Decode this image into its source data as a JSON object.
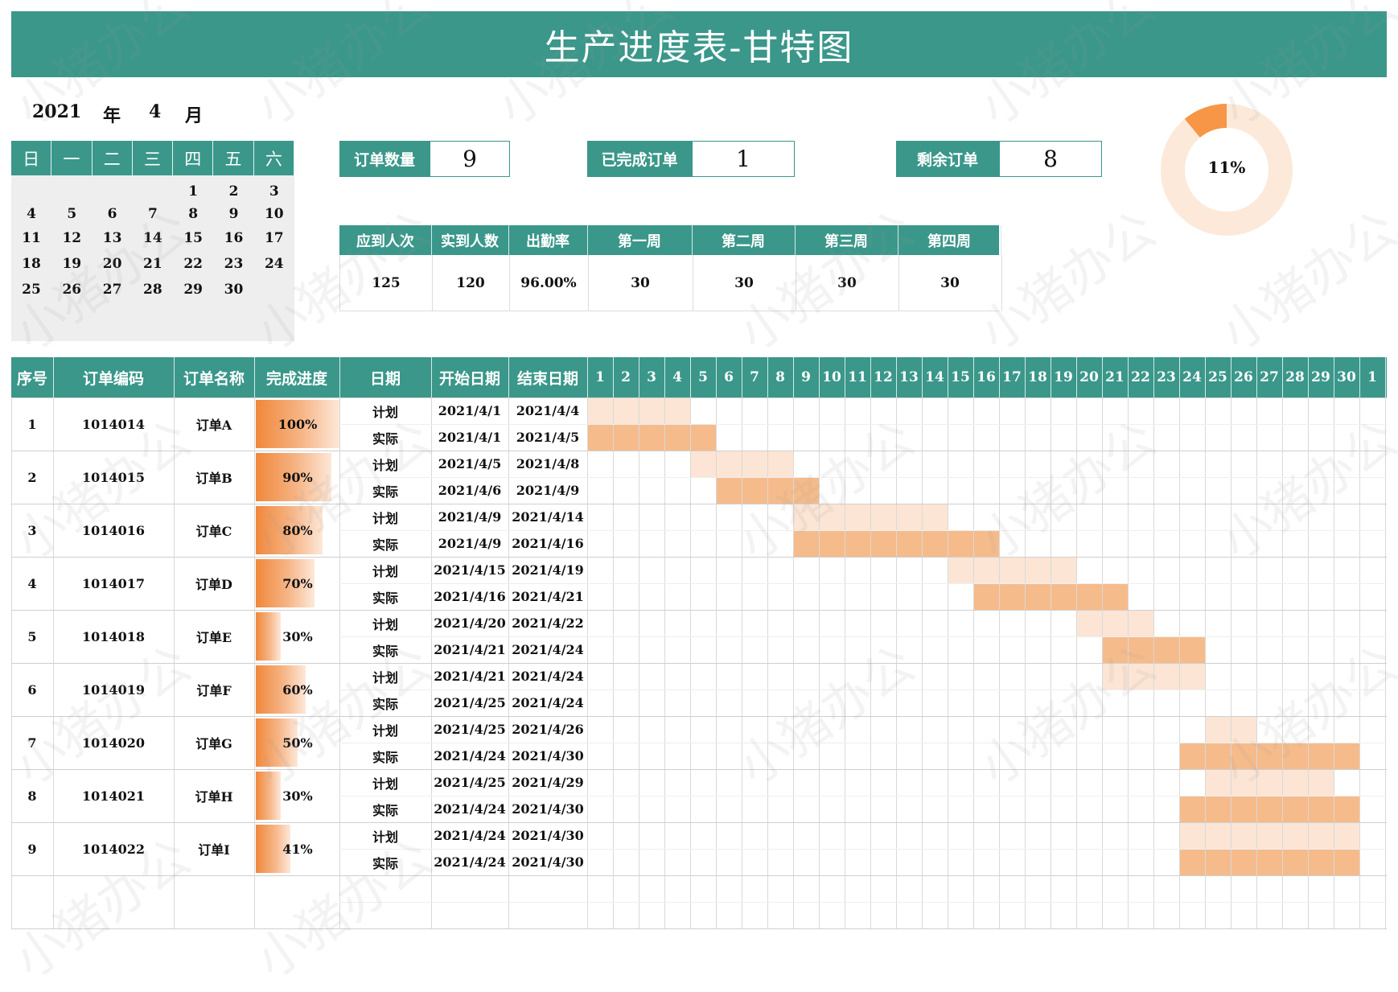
{
  "title": "生产进度表-甘特图",
  "date_header": {
    "year": "2021",
    "year_unit": "年",
    "month": "4",
    "month_unit": "月"
  },
  "calendar": {
    "weekdays": [
      "日",
      "一",
      "二",
      "三",
      "四",
      "五",
      "六"
    ],
    "days": [
      [
        "",
        "",
        "",
        "",
        "1",
        "2",
        "3"
      ],
      [
        "4",
        "5",
        "6",
        "7",
        "8",
        "9",
        "10"
      ],
      [
        "11",
        "12",
        "13",
        "14",
        "15",
        "16",
        "17"
      ],
      [
        "18",
        "19",
        "20",
        "21",
        "22",
        "23",
        "24"
      ],
      [
        "25",
        "26",
        "27",
        "28",
        "29",
        "30",
        ""
      ]
    ]
  },
  "kpis": [
    {
      "label": "订单数量",
      "value": "9"
    },
    {
      "label": "已完成订单",
      "value": "1"
    },
    {
      "label": "剩余订单",
      "value": "8"
    }
  ],
  "donut": {
    "percent": 0.11,
    "label": "11%",
    "fill_color": "#f79646",
    "track_color": "#fde9d9"
  },
  "stats": {
    "headers": [
      "应到人次",
      "实到人数",
      "出勤率",
      "第一周",
      "第二周",
      "第三周",
      "第四周"
    ],
    "values": [
      "125",
      "120",
      "96.00%",
      "30",
      "30",
      "30",
      "30"
    ]
  },
  "table": {
    "headers": [
      "序号",
      "订单编码",
      "订单名称",
      "完成进度",
      "日期",
      "开始日期",
      "结束日期"
    ],
    "day_headers": [
      "1",
      "2",
      "3",
      "4",
      "5",
      "6",
      "7",
      "8",
      "9",
      "10",
      "11",
      "12",
      "13",
      "14",
      "15",
      "16",
      "17",
      "18",
      "19",
      "20",
      "21",
      "22",
      "23",
      "24",
      "25",
      "26",
      "27",
      "28",
      "29",
      "30",
      "1"
    ],
    "plan_label": "计划",
    "actual_label": "实际",
    "orders": [
      {
        "no": "1",
        "code": "1014014",
        "name": "订单A",
        "progress": 1.0,
        "progress_label": "100%",
        "plan": {
          "start": "2021/4/1",
          "end": "2021/4/4",
          "s": 1,
          "e": 4
        },
        "actual": {
          "start": "2021/4/1",
          "end": "2021/4/5",
          "s": 1,
          "e": 5
        }
      },
      {
        "no": "2",
        "code": "1014015",
        "name": "订单B",
        "progress": 0.9,
        "progress_label": "90%",
        "plan": {
          "start": "2021/4/5",
          "end": "2021/4/8",
          "s": 5,
          "e": 8
        },
        "actual": {
          "start": "2021/4/6",
          "end": "2021/4/9",
          "s": 6,
          "e": 9
        }
      },
      {
        "no": "3",
        "code": "1014016",
        "name": "订单C",
        "progress": 0.8,
        "progress_label": "80%",
        "plan": {
          "start": "2021/4/9",
          "end": "2021/4/14",
          "s": 9,
          "e": 14
        },
        "actual": {
          "start": "2021/4/9",
          "end": "2021/4/16",
          "s": 9,
          "e": 16
        }
      },
      {
        "no": "4",
        "code": "1014017",
        "name": "订单D",
        "progress": 0.7,
        "progress_label": "70%",
        "plan": {
          "start": "2021/4/15",
          "end": "2021/4/19",
          "s": 15,
          "e": 19
        },
        "actual": {
          "start": "2021/4/16",
          "end": "2021/4/21",
          "s": 16,
          "e": 21
        }
      },
      {
        "no": "5",
        "code": "1014018",
        "name": "订单E",
        "progress": 0.3,
        "progress_label": "30%",
        "plan": {
          "start": "2021/4/20",
          "end": "2021/4/22",
          "s": 20,
          "e": 22
        },
        "actual": {
          "start": "2021/4/21",
          "end": "2021/4/24",
          "s": 21,
          "e": 24
        }
      },
      {
        "no": "6",
        "code": "1014019",
        "name": "订单F",
        "progress": 0.6,
        "progress_label": "60%",
        "plan": {
          "start": "2021/4/21",
          "end": "2021/4/24",
          "s": 21,
          "e": 24
        },
        "actual": {
          "start": "2021/4/25",
          "end": "2021/4/24",
          "s": 0,
          "e": 0
        }
      },
      {
        "no": "7",
        "code": "1014020",
        "name": "订单G",
        "progress": 0.5,
        "progress_label": "50%",
        "plan": {
          "start": "2021/4/25",
          "end": "2021/4/26",
          "s": 25,
          "e": 26
        },
        "actual": {
          "start": "2021/4/24",
          "end": "2021/4/30",
          "s": 24,
          "e": 30
        }
      },
      {
        "no": "8",
        "code": "1014021",
        "name": "订单H",
        "progress": 0.3,
        "progress_label": "30%",
        "plan": {
          "start": "2021/4/25",
          "end": "2021/4/29",
          "s": 25,
          "e": 29
        },
        "actual": {
          "start": "2021/4/24",
          "end": "2021/4/30",
          "s": 24,
          "e": 30
        }
      },
      {
        "no": "9",
        "code": "1014022",
        "name": "订单I",
        "progress": 0.41,
        "progress_label": "41%",
        "plan": {
          "start": "2021/4/24",
          "end": "2021/4/30",
          "s": 24,
          "e": 30
        },
        "actual": {
          "start": "2021/4/24",
          "end": "2021/4/30",
          "s": 24,
          "e": 30
        }
      }
    ]
  },
  "colors": {
    "header_teal": "#3a978a",
    "plan_fill": "#fce5d4",
    "actual_fill": "#f6bb8b",
    "progress_fill": "#f0883a"
  },
  "watermark": "小猪办公"
}
